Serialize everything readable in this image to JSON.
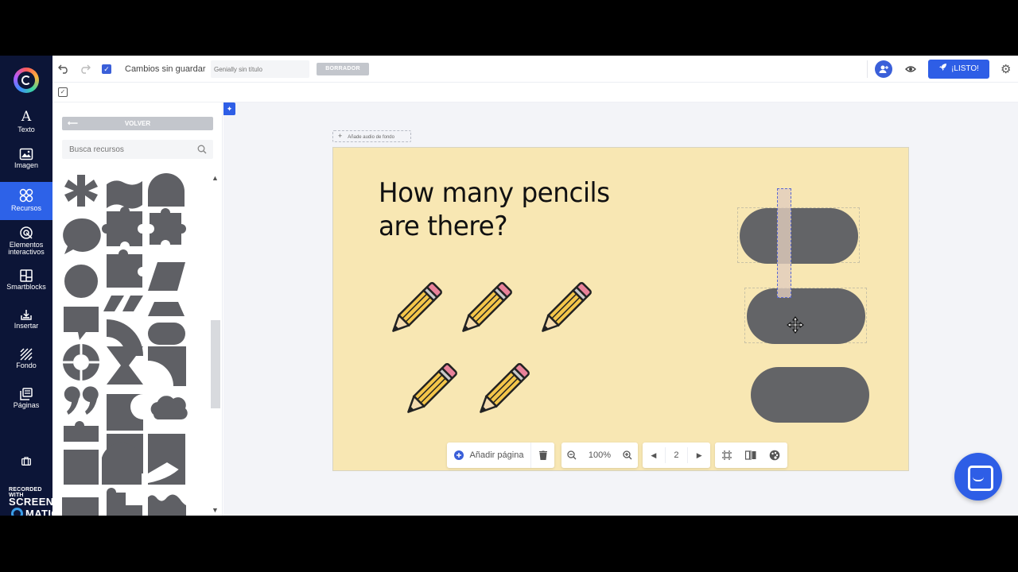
{
  "nav": {
    "items": [
      {
        "label": "Texto",
        "icon": "text-icon"
      },
      {
        "label": "Imagen",
        "icon": "image-icon"
      },
      {
        "label": "Recursos",
        "icon": "resources-icon"
      },
      {
        "label": "Elementos interactivos",
        "icon": "interactive-icon"
      },
      {
        "label": "Smartblocks",
        "icon": "smartblocks-icon"
      },
      {
        "label": "Insertar",
        "icon": "insert-icon"
      },
      {
        "label": "Fondo",
        "icon": "background-icon"
      },
      {
        "label": "Páginas",
        "icon": "pages-icon"
      }
    ],
    "active": "Recursos"
  },
  "toolbar": {
    "status": "Cambios sin guardar",
    "title_placeholder": "Genially sin título",
    "draft_badge": "BORRADOR",
    "publish_label": "¡LISTO!"
  },
  "panel": {
    "back_label": "VOLVER",
    "search_placeholder": "Busca recursos"
  },
  "canvas": {
    "audio_label": "Añade audio de fondo",
    "slide_title_line1": "How many pencils",
    "slide_title_line2": "are there?",
    "background_color": "#f8e7b3",
    "pill_color": "#636467"
  },
  "bottom": {
    "add_page_label": "Añadir página",
    "zoom_level": "100%",
    "page_number": "2"
  },
  "watermark": {
    "line1": "RECORDED WITH",
    "line2_a": "SCREENCAST",
    "line2_b": "MATIC"
  },
  "colors": {
    "nav_bg": "#0c1537",
    "accent": "#2e5ee6"
  }
}
